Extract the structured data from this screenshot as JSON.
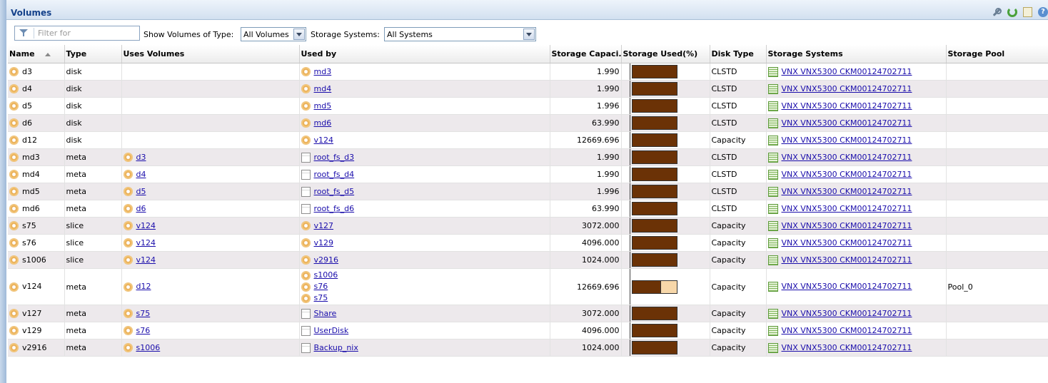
{
  "panel": {
    "title": "Volumes"
  },
  "toolbar": {
    "filter_placeholder": "Filter for",
    "type_label": "Show Volumes of Type:",
    "type_value": "All Volumes",
    "systems_label": "Storage Systems:",
    "systems_value": "All Systems"
  },
  "icons": [
    "wrench-icon",
    "refresh-icon",
    "export-icon",
    "help-icon",
    "filter-icon",
    "volume-icon",
    "filesystem-icon",
    "storage-system-icon"
  ],
  "colors": {
    "bar_used": "#6b3206",
    "bar_free": "#f7d7a9",
    "header_blue": "#15428b"
  },
  "columns": [
    "Name",
    "Type",
    "Uses Volumes",
    "Used by",
    "Storage Capaci...",
    "Storage Used(%)",
    "Disk Type",
    "Storage Systems",
    "Storage Pool"
  ],
  "rows": [
    {
      "name": "d3",
      "type": "disk",
      "uses": "",
      "used_by": [
        {
          "t": "md3",
          "k": "vol"
        }
      ],
      "capacity": "1.990",
      "used_pct": 100,
      "disk_type": "CLSTD",
      "system": "VNX VNX5300 CKM00124702711",
      "pool": ""
    },
    {
      "name": "d4",
      "type": "disk",
      "uses": "",
      "used_by": [
        {
          "t": "md4",
          "k": "vol"
        }
      ],
      "capacity": "1.990",
      "used_pct": 100,
      "disk_type": "CLSTD",
      "system": "VNX VNX5300 CKM00124702711",
      "pool": ""
    },
    {
      "name": "d5",
      "type": "disk",
      "uses": "",
      "used_by": [
        {
          "t": "md5",
          "k": "vol"
        }
      ],
      "capacity": "1.996",
      "used_pct": 100,
      "disk_type": "CLSTD",
      "system": "VNX VNX5300 CKM00124702711",
      "pool": ""
    },
    {
      "name": "d6",
      "type": "disk",
      "uses": "",
      "used_by": [
        {
          "t": "md6",
          "k": "vol"
        }
      ],
      "capacity": "63.990",
      "used_pct": 100,
      "disk_type": "CLSTD",
      "system": "VNX VNX5300 CKM00124702711",
      "pool": ""
    },
    {
      "name": "d12",
      "type": "disk",
      "uses": "",
      "used_by": [
        {
          "t": "v124",
          "k": "vol"
        }
      ],
      "capacity": "12669.696",
      "used_pct": 100,
      "disk_type": "Capacity",
      "system": "VNX VNX5300 CKM00124702711",
      "pool": ""
    },
    {
      "name": "md3",
      "type": "meta",
      "uses": "d3",
      "used_by": [
        {
          "t": "root_fs_d3",
          "k": "fs"
        }
      ],
      "capacity": "1.990",
      "used_pct": 100,
      "disk_type": "CLSTD",
      "system": "VNX VNX5300 CKM00124702711",
      "pool": ""
    },
    {
      "name": "md4",
      "type": "meta",
      "uses": "d4",
      "used_by": [
        {
          "t": "root_fs_d4",
          "k": "fs"
        }
      ],
      "capacity": "1.990",
      "used_pct": 100,
      "disk_type": "CLSTD",
      "system": "VNX VNX5300 CKM00124702711",
      "pool": ""
    },
    {
      "name": "md5",
      "type": "meta",
      "uses": "d5",
      "used_by": [
        {
          "t": "root_fs_d5",
          "k": "fs"
        }
      ],
      "capacity": "1.996",
      "used_pct": 100,
      "disk_type": "CLSTD",
      "system": "VNX VNX5300 CKM00124702711",
      "pool": ""
    },
    {
      "name": "md6",
      "type": "meta",
      "uses": "d6",
      "used_by": [
        {
          "t": "root_fs_d6",
          "k": "fs"
        }
      ],
      "capacity": "63.990",
      "used_pct": 100,
      "disk_type": "CLSTD",
      "system": "VNX VNX5300 CKM00124702711",
      "pool": ""
    },
    {
      "name": "s75",
      "type": "slice",
      "uses": "v124",
      "used_by": [
        {
          "t": "v127",
          "k": "vol"
        }
      ],
      "capacity": "3072.000",
      "used_pct": 100,
      "disk_type": "Capacity",
      "system": "VNX VNX5300 CKM00124702711",
      "pool": ""
    },
    {
      "name": "s76",
      "type": "slice",
      "uses": "v124",
      "used_by": [
        {
          "t": "v129",
          "k": "vol"
        }
      ],
      "capacity": "4096.000",
      "used_pct": 100,
      "disk_type": "Capacity",
      "system": "VNX VNX5300 CKM00124702711",
      "pool": ""
    },
    {
      "name": "s1006",
      "type": "slice",
      "uses": "v124",
      "used_by": [
        {
          "t": "v2916",
          "k": "vol"
        }
      ],
      "capacity": "1024.000",
      "used_pct": 100,
      "disk_type": "Capacity",
      "system": "VNX VNX5300 CKM00124702711",
      "pool": ""
    },
    {
      "name": "v124",
      "type": "meta",
      "uses": "d12",
      "used_by": [
        {
          "t": "s1006",
          "k": "vol"
        },
        {
          "t": "s76",
          "k": "vol"
        },
        {
          "t": "s75",
          "k": "vol"
        }
      ],
      "capacity": "12669.696",
      "used_pct": 65,
      "disk_type": "Capacity",
      "system": "VNX VNX5300 CKM00124702711",
      "pool": "Pool_0"
    },
    {
      "name": "v127",
      "type": "meta",
      "uses": "s75",
      "used_by": [
        {
          "t": "Share",
          "k": "fs"
        }
      ],
      "capacity": "3072.000",
      "used_pct": 100,
      "disk_type": "Capacity",
      "system": "VNX VNX5300 CKM00124702711",
      "pool": ""
    },
    {
      "name": "v129",
      "type": "meta",
      "uses": "s76",
      "used_by": [
        {
          "t": "UserDisk",
          "k": "fs"
        }
      ],
      "capacity": "4096.000",
      "used_pct": 100,
      "disk_type": "Capacity",
      "system": "VNX VNX5300 CKM00124702711",
      "pool": ""
    },
    {
      "name": "v2916",
      "type": "meta",
      "uses": "s1006",
      "used_by": [
        {
          "t": "Backup_nix",
          "k": "fs"
        }
      ],
      "capacity": "1024.000",
      "used_pct": 100,
      "disk_type": "Capacity",
      "system": "VNX VNX5300 CKM00124702711",
      "pool": ""
    }
  ]
}
